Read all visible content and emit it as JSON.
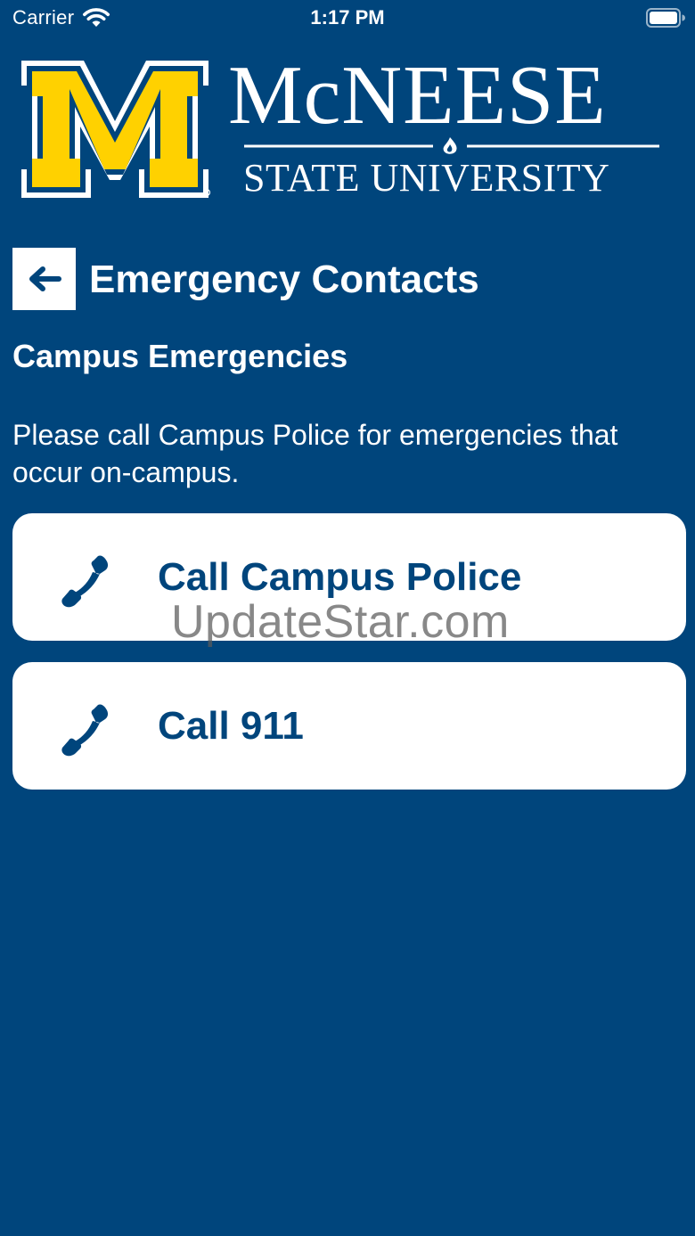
{
  "status_bar": {
    "carrier": "Carrier",
    "time": "1:17 PM",
    "wifi_icon": "wifi-icon",
    "battery_icon": "battery-icon"
  },
  "logo": {
    "main_text": "McNEESE",
    "sub_text": "STATE UNIVERSITY",
    "colors": {
      "gold": "#ffd100",
      "blue": "#00457c",
      "white": "#ffffff"
    }
  },
  "header": {
    "back_icon": "arrow-left-icon",
    "title": "Emergency Contacts"
  },
  "section": {
    "title": "Campus Emergencies",
    "description": "Please call Campus Police for emergencies that occur on-campus."
  },
  "buttons": [
    {
      "label": "Call Campus Police",
      "icon": "phone-icon"
    },
    {
      "label": "Call 911",
      "icon": "phone-icon"
    }
  ],
  "watermark": "UpdateStar.com",
  "colors": {
    "background": "#00457c",
    "button_background": "#ffffff",
    "button_text": "#00457c"
  }
}
